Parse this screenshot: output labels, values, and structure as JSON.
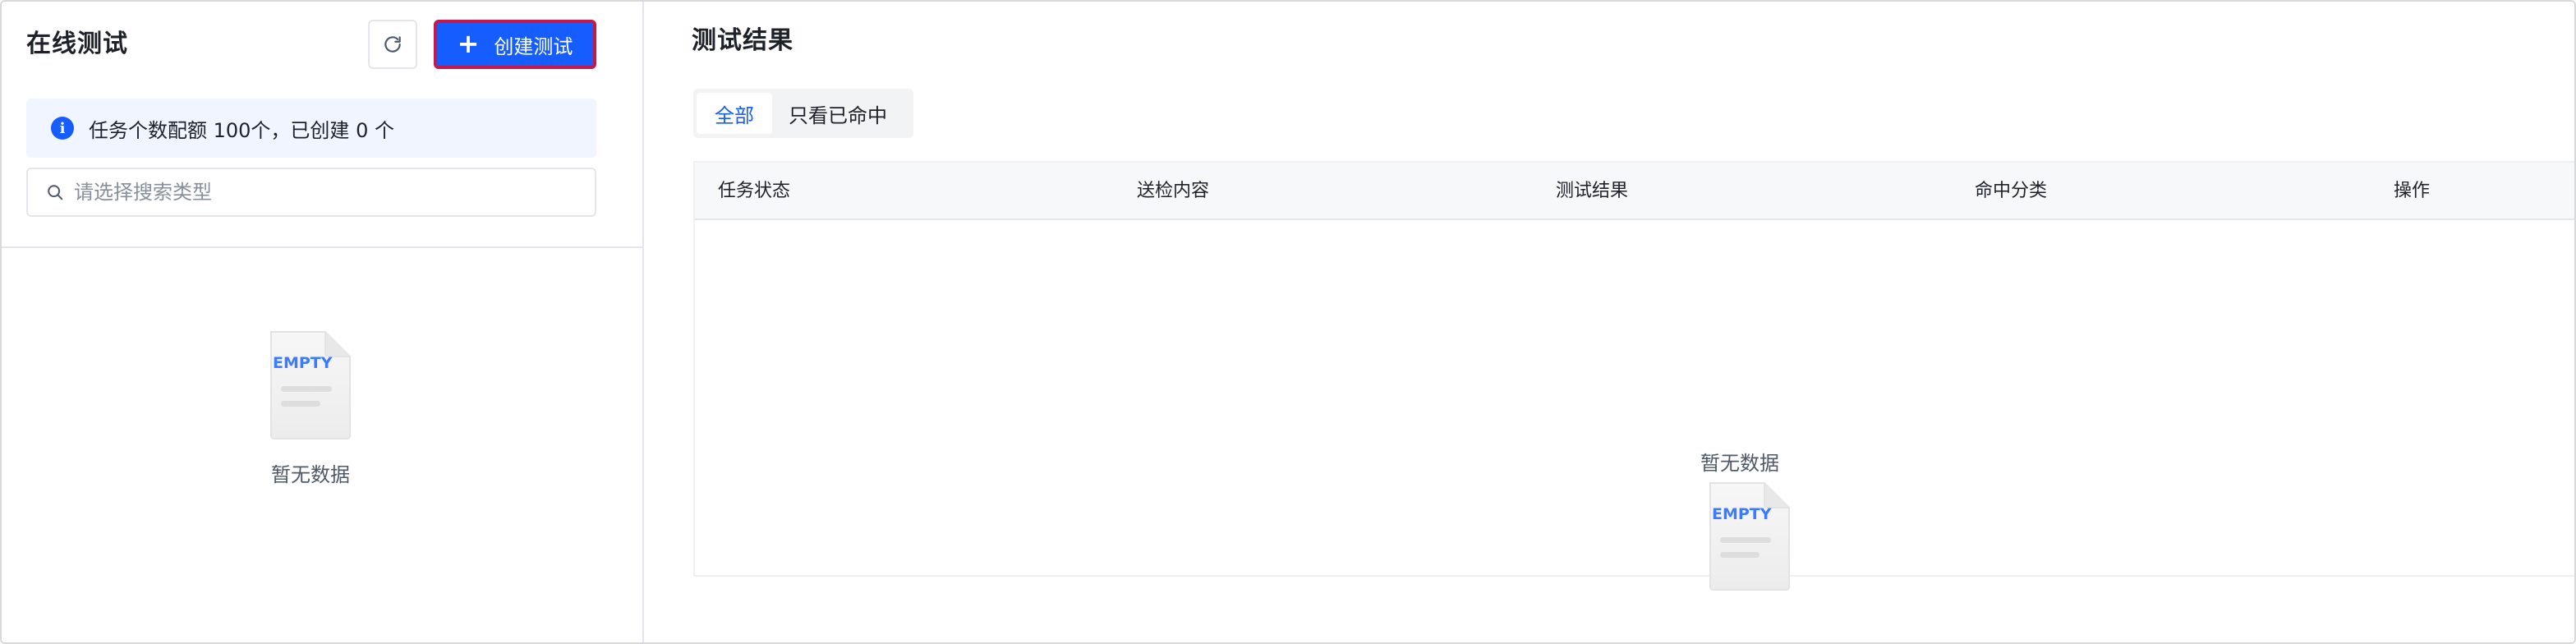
{
  "left_panel": {
    "title": "在线测试",
    "create_button_label": "创建测试",
    "quota_text": "任务个数配额 100个，已创建 0 个",
    "search_placeholder": "请选择搜索类型",
    "empty_text": "暂无数据",
    "empty_illustration_text": "EMPTY"
  },
  "right_panel": {
    "title": "测试结果",
    "segments": [
      {
        "label": "全部",
        "active": true
      },
      {
        "label": "只看已命中",
        "active": false
      }
    ],
    "table": {
      "columns": [
        "任务状态",
        "送检内容",
        "测试结果",
        "命中分类",
        "操作"
      ],
      "rows": []
    },
    "empty_text": "暂无数据",
    "empty_illustration_text": "EMPTY"
  },
  "colors": {
    "primary": "#165dff",
    "button_border_highlight": "#c4194a",
    "info_bg": "#f0f5ff",
    "header_bg": "#f7f8fa",
    "muted_text": "#86909c"
  },
  "icons": {
    "refresh": "refresh-icon",
    "plus": "plus-icon",
    "info": "info-icon",
    "search": "search-icon",
    "empty": "empty-file-icon"
  }
}
